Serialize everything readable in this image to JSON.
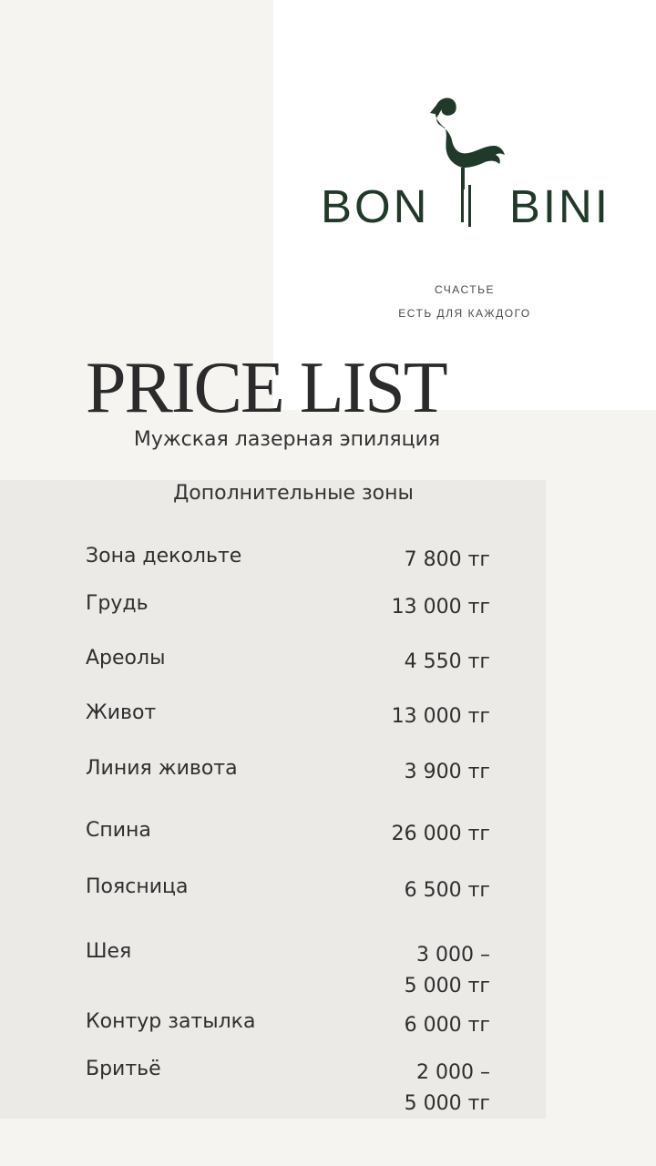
{
  "brand": {
    "left": "BON",
    "right": "BINI",
    "tagline_1": "СЧАСТЬЕ",
    "tagline_2": "ЕСТЬ ДЛЯ КАЖДОГО"
  },
  "title": "PRICE LIST",
  "subtitle": "Мужская лазерная эпиляция",
  "section": "Дополнительные зоны",
  "items": [
    {
      "name": "Зона декольте",
      "price": "7 800 тг"
    },
    {
      "name": "Грудь",
      "price": "13 000 тг"
    },
    {
      "name": "Ареолы",
      "price": "4 550 тг"
    },
    {
      "name": "Живот",
      "price": "13 000 тг"
    },
    {
      "name": "Линия живота",
      "price": "3 900 тг"
    },
    {
      "name": "Спина",
      "price": "26 000 тг"
    },
    {
      "name": "Поясница",
      "price": "6 500 тг"
    },
    {
      "name": "Шея",
      "price": "3 000 –\n5 000 тг"
    },
    {
      "name": "Контур затылка",
      "price": "6 000 тг"
    },
    {
      "name": "Бритьё",
      "price": "2 000 –\n5 000 тг"
    }
  ],
  "colors": {
    "brand_green": "#1f3a28",
    "background": "#f5f4f1",
    "panel": "#ebeae7"
  }
}
